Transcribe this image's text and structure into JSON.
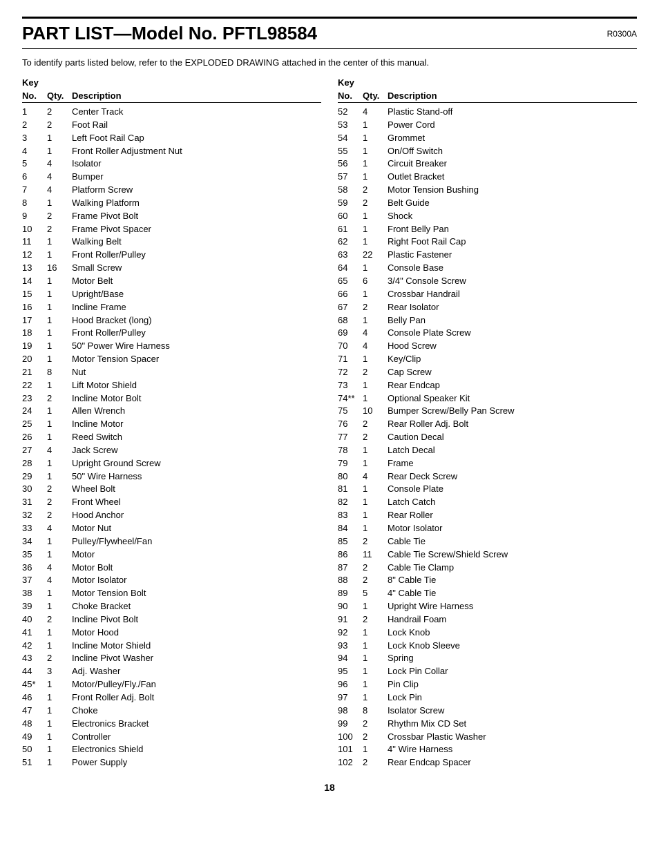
{
  "header": {
    "title": "PART LIST—Model No. PFTL98584",
    "revision": "R0300A"
  },
  "intro": "To identify parts listed below, refer to the EXPLODED DRAWING attached in the center of this manual.",
  "col_headers": {
    "key": "Key",
    "no": "No.",
    "qty": "Qty.",
    "description": "Description"
  },
  "left_parts": [
    {
      "no": "1",
      "qty": "2",
      "desc": "Center Track"
    },
    {
      "no": "2",
      "qty": "2",
      "desc": "Foot Rail"
    },
    {
      "no": "3",
      "qty": "1",
      "desc": "Left Foot Rail Cap"
    },
    {
      "no": "4",
      "qty": "1",
      "desc": "Front Roller Adjustment Nut"
    },
    {
      "no": "5",
      "qty": "4",
      "desc": "Isolator"
    },
    {
      "no": "6",
      "qty": "4",
      "desc": "Bumper"
    },
    {
      "no": "7",
      "qty": "4",
      "desc": "Platform Screw"
    },
    {
      "no": "8",
      "qty": "1",
      "desc": "Walking Platform"
    },
    {
      "no": "9",
      "qty": "2",
      "desc": "Frame Pivot Bolt"
    },
    {
      "no": "10",
      "qty": "2",
      "desc": "Frame Pivot Spacer"
    },
    {
      "no": "11",
      "qty": "1",
      "desc": "Walking Belt"
    },
    {
      "no": "12",
      "qty": "1",
      "desc": "Front Roller/Pulley"
    },
    {
      "no": "13",
      "qty": "16",
      "desc": "Small Screw"
    },
    {
      "no": "14",
      "qty": "1",
      "desc": "Motor Belt"
    },
    {
      "no": "15",
      "qty": "1",
      "desc": "Upright/Base"
    },
    {
      "no": "16",
      "qty": "1",
      "desc": "Incline Frame"
    },
    {
      "no": "17",
      "qty": "1",
      "desc": "Hood Bracket (long)"
    },
    {
      "no": "18",
      "qty": "1",
      "desc": "Front Roller/Pulley"
    },
    {
      "no": "19",
      "qty": "1",
      "desc": "50\" Power Wire Harness"
    },
    {
      "no": "20",
      "qty": "1",
      "desc": "Motor Tension Spacer"
    },
    {
      "no": "21",
      "qty": "8",
      "desc": "Nut"
    },
    {
      "no": "22",
      "qty": "1",
      "desc": "Lift Motor Shield"
    },
    {
      "no": "23",
      "qty": "2",
      "desc": "Incline Motor Bolt"
    },
    {
      "no": "24",
      "qty": "1",
      "desc": "Allen Wrench"
    },
    {
      "no": "25",
      "qty": "1",
      "desc": "Incline Motor"
    },
    {
      "no": "26",
      "qty": "1",
      "desc": "Reed Switch"
    },
    {
      "no": "27",
      "qty": "4",
      "desc": "Jack Screw"
    },
    {
      "no": "28",
      "qty": "1",
      "desc": "Upright Ground Screw"
    },
    {
      "no": "29",
      "qty": "1",
      "desc": "50\" Wire Harness"
    },
    {
      "no": "30",
      "qty": "2",
      "desc": "Wheel Bolt"
    },
    {
      "no": "31",
      "qty": "2",
      "desc": "Front Wheel"
    },
    {
      "no": "32",
      "qty": "2",
      "desc": "Hood Anchor"
    },
    {
      "no": "33",
      "qty": "4",
      "desc": "Motor Nut"
    },
    {
      "no": "34",
      "qty": "1",
      "desc": "Pulley/Flywheel/Fan"
    },
    {
      "no": "35",
      "qty": "1",
      "desc": "Motor"
    },
    {
      "no": "36",
      "qty": "4",
      "desc": "Motor Bolt"
    },
    {
      "no": "37",
      "qty": "4",
      "desc": "Motor Isolator"
    },
    {
      "no": "38",
      "qty": "1",
      "desc": "Motor Tension Bolt"
    },
    {
      "no": "39",
      "qty": "1",
      "desc": "Choke Bracket"
    },
    {
      "no": "40",
      "qty": "2",
      "desc": "Incline Pivot Bolt"
    },
    {
      "no": "41",
      "qty": "1",
      "desc": "Motor Hood"
    },
    {
      "no": "42",
      "qty": "1",
      "desc": "Incline Motor Shield"
    },
    {
      "no": "43",
      "qty": "2",
      "desc": "Incline Pivot Washer"
    },
    {
      "no": "44",
      "qty": "3",
      "desc": "Adj. Washer"
    },
    {
      "no": "45*",
      "qty": "1",
      "desc": "Motor/Pulley/Fly./Fan"
    },
    {
      "no": "46",
      "qty": "1",
      "desc": "Front Roller Adj. Bolt"
    },
    {
      "no": "47",
      "qty": "1",
      "desc": "Choke"
    },
    {
      "no": "48",
      "qty": "1",
      "desc": "Electronics Bracket"
    },
    {
      "no": "49",
      "qty": "1",
      "desc": "Controller"
    },
    {
      "no": "50",
      "qty": "1",
      "desc": "Electronics Shield"
    },
    {
      "no": "51",
      "qty": "1",
      "desc": "Power Supply"
    }
  ],
  "right_parts": [
    {
      "no": "52",
      "qty": "4",
      "desc": "Plastic Stand-off"
    },
    {
      "no": "53",
      "qty": "1",
      "desc": "Power Cord"
    },
    {
      "no": "54",
      "qty": "1",
      "desc": "Grommet"
    },
    {
      "no": "55",
      "qty": "1",
      "desc": "On/Off Switch"
    },
    {
      "no": "56",
      "qty": "1",
      "desc": "Circuit Breaker"
    },
    {
      "no": "57",
      "qty": "1",
      "desc": "Outlet Bracket"
    },
    {
      "no": "58",
      "qty": "2",
      "desc": "Motor Tension Bushing"
    },
    {
      "no": "59",
      "qty": "2",
      "desc": "Belt Guide"
    },
    {
      "no": "60",
      "qty": "1",
      "desc": "Shock"
    },
    {
      "no": "61",
      "qty": "1",
      "desc": "Front Belly Pan"
    },
    {
      "no": "62",
      "qty": "1",
      "desc": "Right Foot Rail Cap"
    },
    {
      "no": "63",
      "qty": "22",
      "desc": "Plastic Fastener"
    },
    {
      "no": "64",
      "qty": "1",
      "desc": "Console Base"
    },
    {
      "no": "65",
      "qty": "6",
      "desc": "3/4\" Console Screw"
    },
    {
      "no": "66",
      "qty": "1",
      "desc": "Crossbar Handrail"
    },
    {
      "no": "67",
      "qty": "2",
      "desc": "Rear Isolator"
    },
    {
      "no": "68",
      "qty": "1",
      "desc": "Belly Pan"
    },
    {
      "no": "69",
      "qty": "4",
      "desc": "Console Plate Screw"
    },
    {
      "no": "70",
      "qty": "4",
      "desc": "Hood Screw"
    },
    {
      "no": "71",
      "qty": "1",
      "desc": "Key/Clip"
    },
    {
      "no": "72",
      "qty": "2",
      "desc": "Cap Screw"
    },
    {
      "no": "73",
      "qty": "1",
      "desc": "Rear Endcap"
    },
    {
      "no": "74**",
      "qty": "1",
      "desc": "Optional Speaker Kit"
    },
    {
      "no": "75",
      "qty": "10",
      "desc": "Bumper Screw/Belly Pan Screw"
    },
    {
      "no": "76",
      "qty": "2",
      "desc": "Rear Roller Adj. Bolt"
    },
    {
      "no": "77",
      "qty": "2",
      "desc": "Caution Decal"
    },
    {
      "no": "78",
      "qty": "1",
      "desc": "Latch Decal"
    },
    {
      "no": "79",
      "qty": "1",
      "desc": "Frame"
    },
    {
      "no": "80",
      "qty": "4",
      "desc": "Rear Deck Screw"
    },
    {
      "no": "81",
      "qty": "1",
      "desc": "Console Plate"
    },
    {
      "no": "82",
      "qty": "1",
      "desc": "Latch Catch"
    },
    {
      "no": "83",
      "qty": "1",
      "desc": "Rear Roller"
    },
    {
      "no": "84",
      "qty": "1",
      "desc": "Motor Isolator"
    },
    {
      "no": "85",
      "qty": "2",
      "desc": "Cable Tie"
    },
    {
      "no": "86",
      "qty": "11",
      "desc": "Cable Tie Screw/Shield Screw"
    },
    {
      "no": "87",
      "qty": "2",
      "desc": "Cable Tie Clamp"
    },
    {
      "no": "88",
      "qty": "2",
      "desc": "8\" Cable Tie"
    },
    {
      "no": "89",
      "qty": "5",
      "desc": "4\" Cable Tie"
    },
    {
      "no": "90",
      "qty": "1",
      "desc": "Upright Wire Harness"
    },
    {
      "no": "91",
      "qty": "2",
      "desc": "Handrail Foam"
    },
    {
      "no": "92",
      "qty": "1",
      "desc": "Lock Knob"
    },
    {
      "no": "93",
      "qty": "1",
      "desc": "Lock Knob Sleeve"
    },
    {
      "no": "94",
      "qty": "1",
      "desc": "Spring"
    },
    {
      "no": "95",
      "qty": "1",
      "desc": "Lock Pin Collar"
    },
    {
      "no": "96",
      "qty": "1",
      "desc": "Pin Clip"
    },
    {
      "no": "97",
      "qty": "1",
      "desc": "Lock Pin"
    },
    {
      "no": "98",
      "qty": "8",
      "desc": "Isolator Screw"
    },
    {
      "no": "99",
      "qty": "2",
      "desc": "Rhythm Mix CD Set"
    },
    {
      "no": "100",
      "qty": "2",
      "desc": "Crossbar Plastic Washer"
    },
    {
      "no": "101",
      "qty": "1",
      "desc": "4\" Wire Harness"
    },
    {
      "no": "102",
      "qty": "2",
      "desc": "Rear Endcap Spacer"
    }
  ],
  "footer": {
    "page_number": "18"
  }
}
